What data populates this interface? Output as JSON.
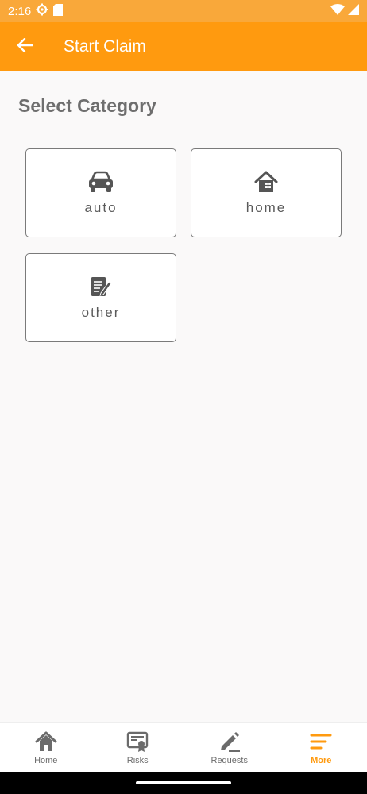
{
  "status_bar": {
    "time": "2:16"
  },
  "app_bar": {
    "title": "Start Claim"
  },
  "section": {
    "title": "Select Category"
  },
  "categories": [
    {
      "label": "auto",
      "icon": "car-icon"
    },
    {
      "label": "home",
      "icon": "house-icon"
    },
    {
      "label": "other",
      "icon": "document-edit-icon"
    }
  ],
  "bottom_nav": [
    {
      "label": "Home",
      "icon": "home-icon",
      "active": false
    },
    {
      "label": "Risks",
      "icon": "certificate-icon",
      "active": false
    },
    {
      "label": "Requests",
      "icon": "pencil-icon",
      "active": false
    },
    {
      "label": "More",
      "icon": "menu-icon",
      "active": true
    }
  ],
  "colors": {
    "primary": "#ff9a0f",
    "status_bar": "#f9a83a",
    "background": "#faf9f9",
    "text_gray": "#6e6e6e"
  }
}
